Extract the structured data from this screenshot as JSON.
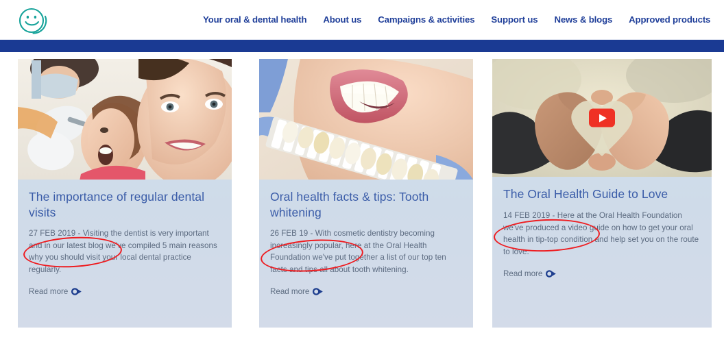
{
  "header": {
    "logo_name": "oral-health-foundation-smiley-logo",
    "logo_color": "#16a39a",
    "nav": [
      {
        "label": "Your oral & dental health"
      },
      {
        "label": "About us"
      },
      {
        "label": "Campaigns & activities"
      },
      {
        "label": "Support us"
      },
      {
        "label": "News & blogs"
      },
      {
        "label": "Approved products"
      }
    ],
    "nav_color": "#21409a",
    "accent_bar_color": "#1a3a93"
  },
  "annotation": {
    "color": "#ee1c20",
    "shape": "ellipse",
    "note": "red hand-drawn ellipses circling each article date"
  },
  "cards": [
    {
      "image_name": "dentist-examining-patient-photo",
      "title": "The importance of regular dental visits",
      "date": "27 FEB 2019",
      "separator": " - ",
      "excerpt": "Visiting the dentist is very important and in our latest blog we've compiled 5 main reasons why you should visit your local dental practice regularly.",
      "read_more": "Read more",
      "has_video": false
    },
    {
      "image_name": "tooth-whitening-shade-guide-photo",
      "title": "Oral health facts & tips: Tooth whitening",
      "date": "26 FEB 19",
      "separator": " - ",
      "excerpt": "With cosmetic dentistry becoming increasingly popular, here at the Oral Health Foundation we've put together a list of our top ten facts and tips all about tooth whitening.",
      "read_more": "Read more",
      "has_video": false
    },
    {
      "image_name": "hands-forming-heart-video-thumbnail",
      "title": "The Oral Health Guide to Love",
      "date": "14 FEB 2019",
      "separator": " - ",
      "excerpt": "Here at the Oral Health Foundation we've produced a video guide on how to get your oral health in tip-top condition and help set you on the route to love.",
      "read_more": "Read more",
      "has_video": true,
      "video_play_label": "youtube-play-button"
    }
  ],
  "colors": {
    "card_background": "#cfdce9",
    "title": "#3a5ca8",
    "body_text": "#5c6b80",
    "youtube_red": "#ef3124"
  }
}
